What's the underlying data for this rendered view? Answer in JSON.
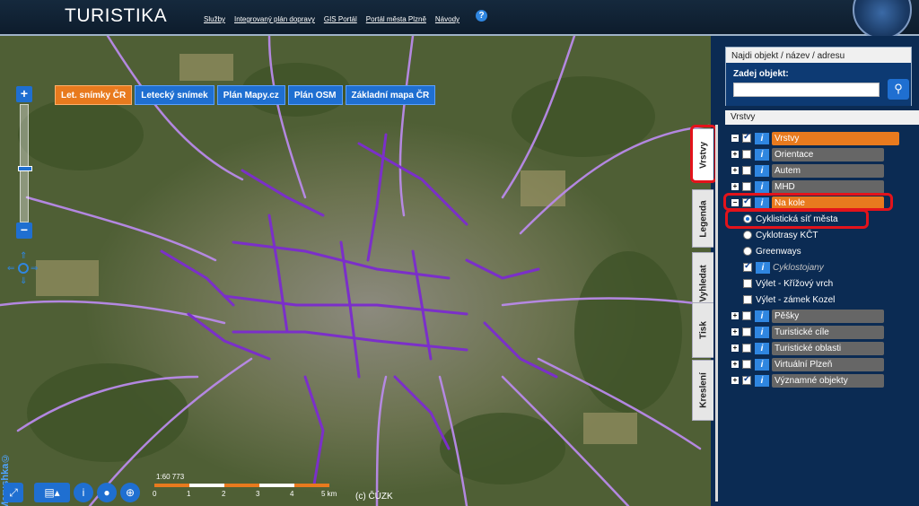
{
  "app": {
    "title": "TURISTIKA"
  },
  "top_links": [
    "Služby",
    "Integrovaný plán dopravy",
    "GIS Portál",
    "Portál města Plzně",
    "Návody"
  ],
  "help_label": "?",
  "basemaps": [
    {
      "label": "Let. snímky ČR",
      "active": true
    },
    {
      "label": "Letecký snímek",
      "active": false
    },
    {
      "label": "Plán Mapy.cz",
      "active": false
    },
    {
      "label": "Plán OSM",
      "active": false
    },
    {
      "label": "Základní mapa ČR",
      "active": false
    }
  ],
  "zoom": {
    "plus": "+",
    "minus": "−"
  },
  "watermark": "Marushka©",
  "scale": {
    "label": "1:60 773",
    "ticks": [
      "0",
      "1",
      "2",
      "3",
      "4",
      "5 km"
    ]
  },
  "copyright": "(c) ČÚZK",
  "search": {
    "title": "Najdi objekt / název / adresu",
    "label": "Zadej objekt:",
    "value": ""
  },
  "layers_panel": {
    "title": "Vrstvy",
    "tabs": [
      "Vrstvy",
      "Legenda",
      "Vyhledat",
      "Tisk",
      "Kreslení"
    ],
    "layers": [
      {
        "label": "Vrstvy",
        "checked": true,
        "style": "orange"
      },
      {
        "label": "Orientace",
        "checked": false,
        "style": "grey"
      },
      {
        "label": "Autem",
        "checked": false,
        "style": "grey"
      },
      {
        "label": "MHD",
        "checked": false,
        "style": "grey"
      },
      {
        "label": "Na kole",
        "checked": true,
        "style": "orange"
      }
    ],
    "sublayers": [
      {
        "label": "Cyklistická síť města",
        "type": "radio",
        "on": true
      },
      {
        "label": "Cyklotrasy KČT",
        "type": "radio",
        "on": false
      },
      {
        "label": "Greenways",
        "type": "radio",
        "on": false
      },
      {
        "label": "Cyklostojany",
        "type": "check",
        "on": true
      },
      {
        "label": "Výlet - Křížový vrch",
        "type": "check",
        "on": false
      },
      {
        "label": "Výlet - zámek Kozel",
        "type": "check",
        "on": false
      }
    ],
    "more_layers": [
      {
        "label": "Pěšky",
        "checked": false
      },
      {
        "label": "Turistické cíle",
        "checked": false
      },
      {
        "label": "Turistické oblasti",
        "checked": false
      },
      {
        "label": "Virtuální Plzeň",
        "checked": false
      },
      {
        "label": "Významné objekty",
        "checked": true
      }
    ]
  },
  "colors": {
    "accent": "#1f6fd1",
    "active": "#e87a1e",
    "panel": "#0b2b53",
    "highlight": "#e3131b",
    "route": "#8a2be2"
  }
}
